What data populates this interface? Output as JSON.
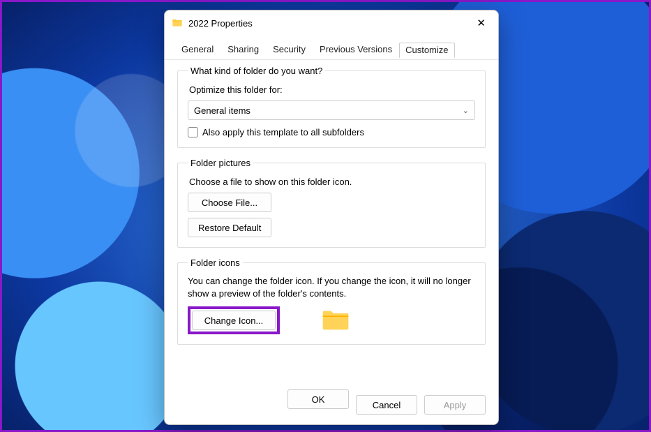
{
  "window": {
    "title": "2022 Properties"
  },
  "tabs": {
    "general": "General",
    "sharing": "Sharing",
    "security": "Security",
    "previous": "Previous Versions",
    "customize": "Customize"
  },
  "section_kind": {
    "legend": "What kind of folder do you want?",
    "optimize_label": "Optimize this folder for:",
    "selected": "General items",
    "checkbox_label": "Also apply this template to all subfolders"
  },
  "section_pictures": {
    "legend": "Folder pictures",
    "desc": "Choose a file to show on this folder icon.",
    "choose_btn": "Choose File...",
    "restore_btn": "Restore Default"
  },
  "section_icons": {
    "legend": "Folder icons",
    "desc": "You can change the folder icon. If you change the icon, it will no longer show a preview of the folder's contents.",
    "change_btn": "Change Icon..."
  },
  "footer": {
    "ok": "OK",
    "cancel": "Cancel",
    "apply": "Apply"
  }
}
